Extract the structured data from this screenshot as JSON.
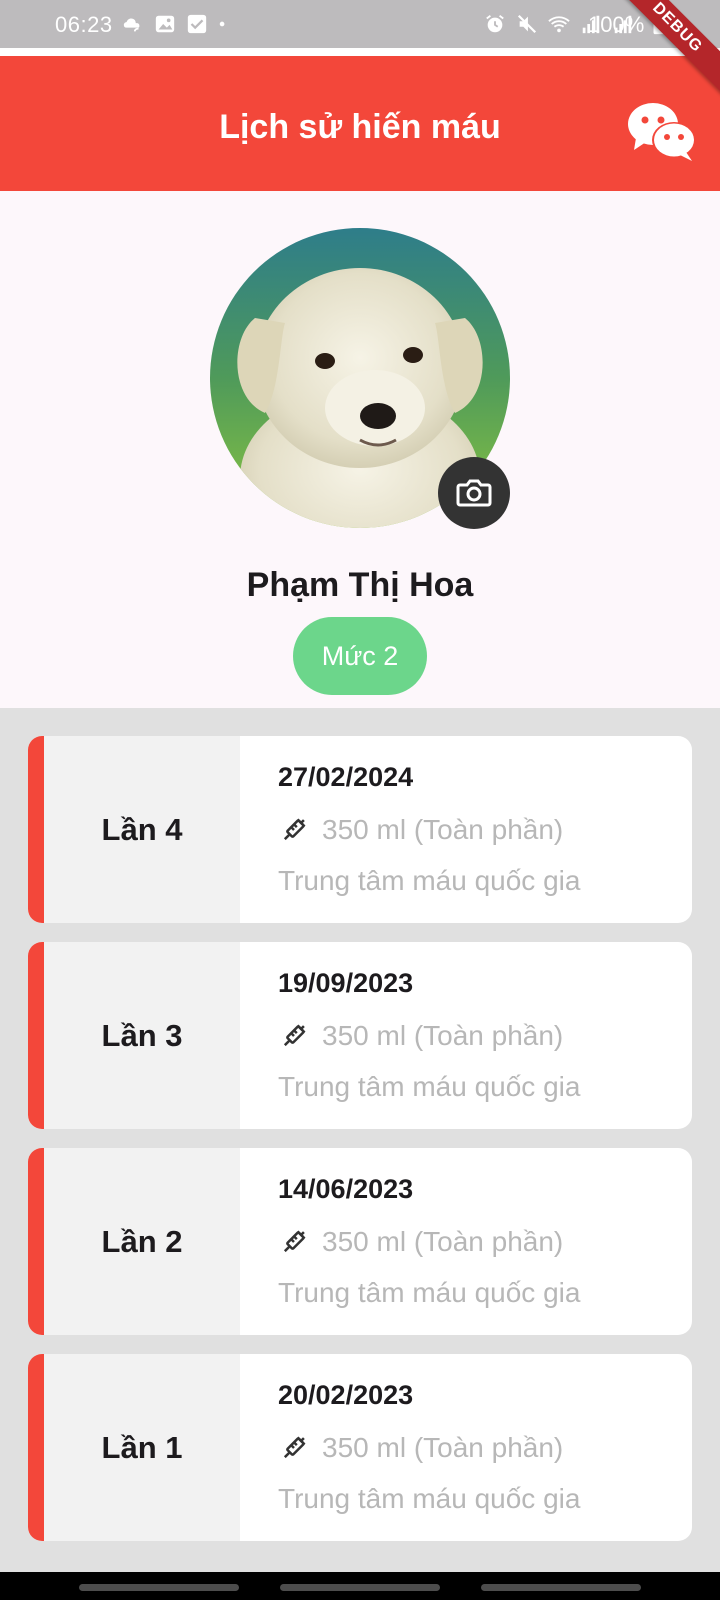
{
  "status_bar": {
    "time": "06:23",
    "battery": "100%",
    "left_icons": [
      "cloud-icon",
      "image-icon",
      "checkbox-icon",
      "dot-icon"
    ],
    "right_icons": [
      "alarm-icon",
      "mute-icon",
      "wifi-icon",
      "signal-icon",
      "signal-icon",
      "battery-icon"
    ]
  },
  "debug_banner": "DEBUG",
  "app_bar": {
    "title": "Lịch sử hiến máu",
    "chat_icon": "wechat-icon"
  },
  "profile": {
    "name": "Phạm Thị Hoa",
    "level": "Mức 2",
    "avatar": "puppy-photo",
    "camera_icon": "camera-icon"
  },
  "history": [
    {
      "label": "Lần 4",
      "date": "27/02/2024",
      "volume": "350 ml (Toàn phần)",
      "location": "Trung tâm máu quốc gia"
    },
    {
      "label": "Lần 3",
      "date": "19/09/2023",
      "volume": "350 ml (Toàn phần)",
      "location": "Trung tâm máu quốc gia"
    },
    {
      "label": "Lần 2",
      "date": "14/06/2023",
      "volume": "350 ml (Toàn phần)",
      "location": "Trung tâm máu quốc gia"
    },
    {
      "label": "Lần 1",
      "date": "20/02/2023",
      "volume": "350 ml (Toàn phần)",
      "location": "Trung tâm máu quốc gia"
    }
  ],
  "colors": {
    "primary": "#f3473a",
    "level_badge": "#6cd68b",
    "muted_text": "#b7b7b7",
    "page_bg": "#e0e0e0"
  }
}
